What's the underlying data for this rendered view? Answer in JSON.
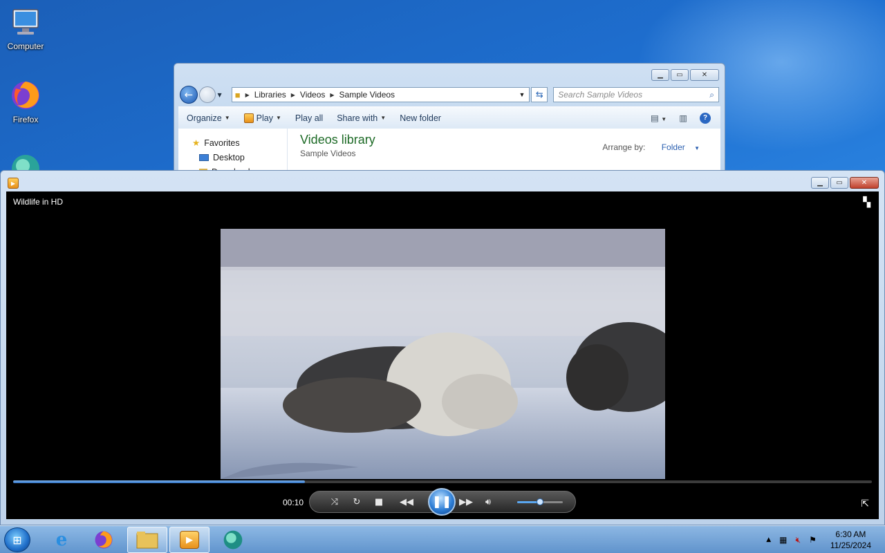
{
  "desktop": {
    "icons": [
      {
        "label": "Computer",
        "icon": "computer-icon"
      },
      {
        "label": "Firefox",
        "icon": "firefox-icon"
      }
    ]
  },
  "explorer": {
    "breadcrumb": [
      "Libraries",
      "Videos",
      "Sample Videos"
    ],
    "search_placeholder": "Search Sample Videos",
    "toolbar": {
      "organize": "Organize",
      "play": "Play",
      "play_all": "Play all",
      "share_with": "Share with",
      "new_folder": "New folder"
    },
    "nav": {
      "favorites": "Favorites",
      "desktop": "Desktop",
      "downloads": "Downloads"
    },
    "library": {
      "title": "Videos library",
      "subtitle": "Sample Videos",
      "arrange_label": "Arrange by:",
      "arrange_value": "Folder"
    }
  },
  "player": {
    "video_title": "Wildlife in HD",
    "time": "00:10",
    "progress": 0.34,
    "volume": 0.5
  },
  "taskbar": {
    "time": "6:30 AM",
    "date": "11/25/2024"
  },
  "colors": {
    "library_title": "#1e6b27",
    "accent": "#2f7fd6"
  }
}
